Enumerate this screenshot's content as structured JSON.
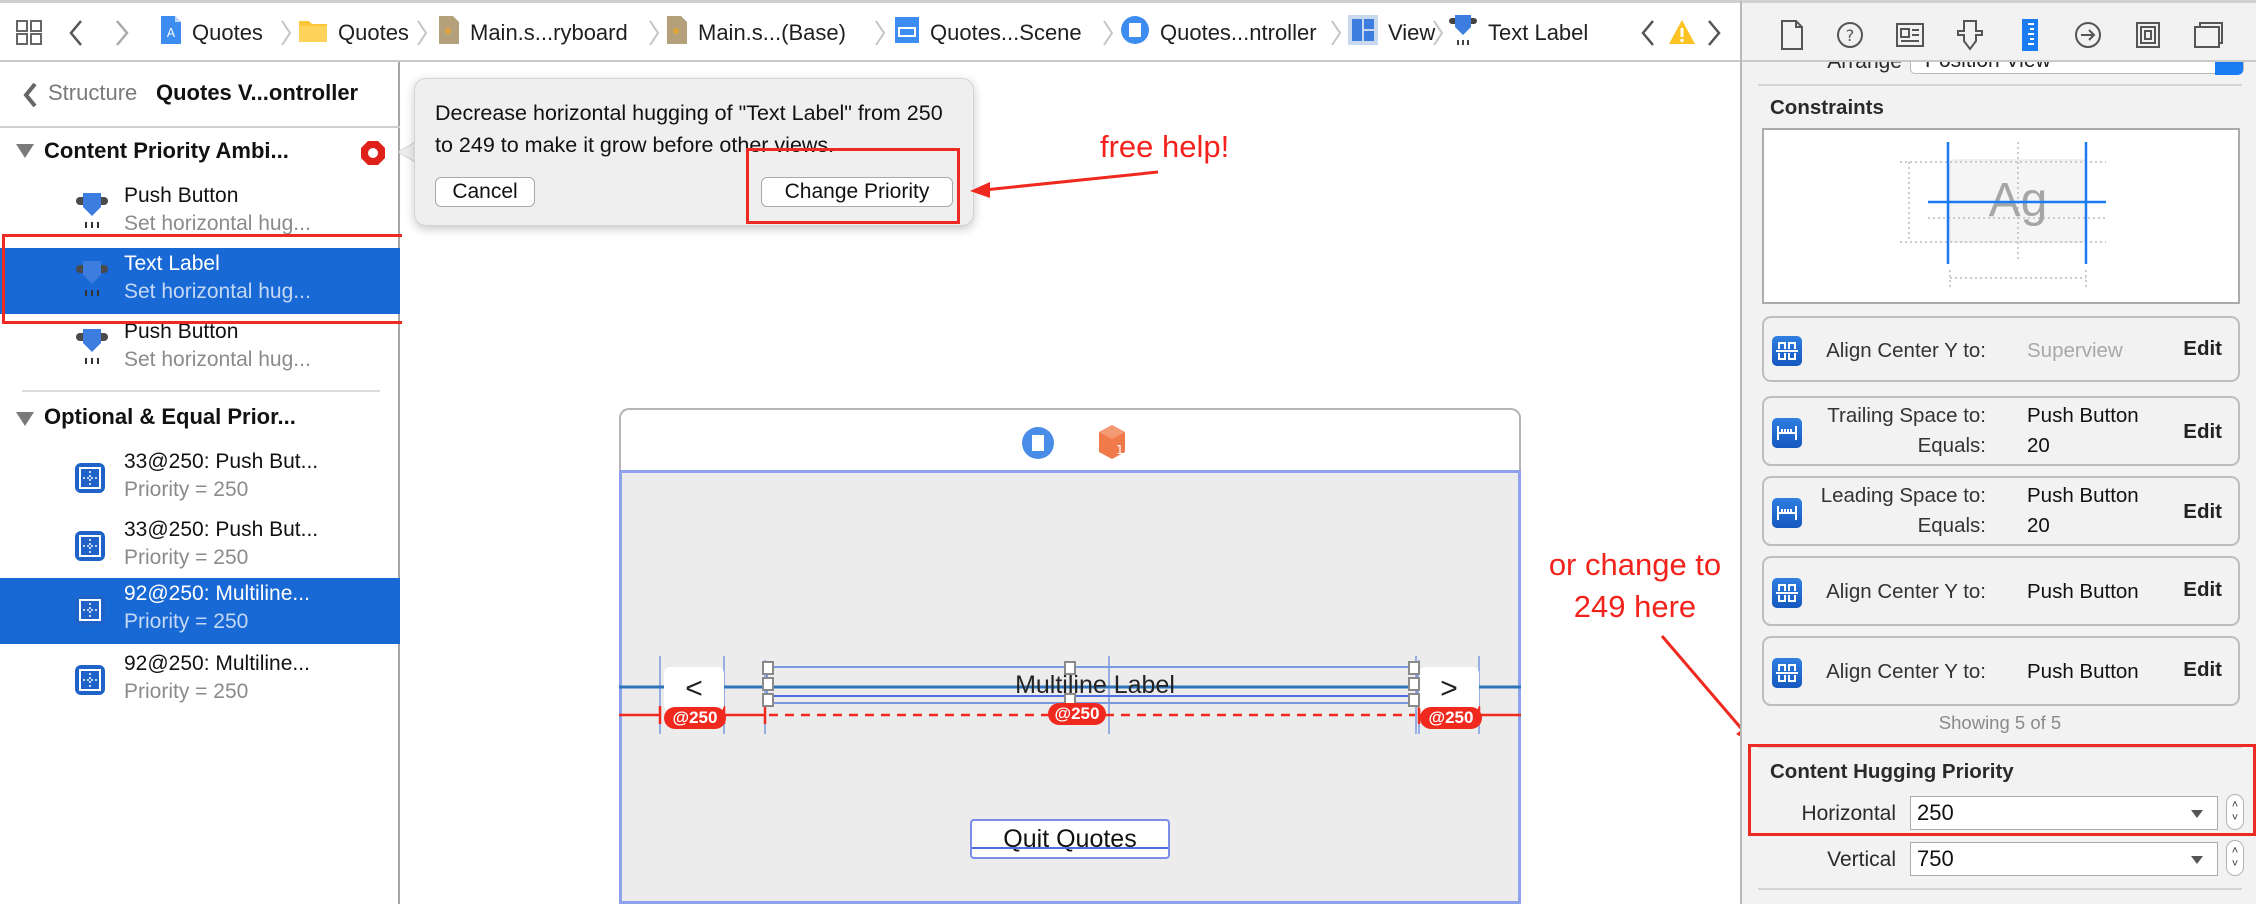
{
  "jumpbar": {
    "breadcrumbs": [
      {
        "label": "Quotes",
        "icon": "project-icon"
      },
      {
        "label": "Quotes",
        "icon": "folder-icon"
      },
      {
        "label": "Main.s...ryboard",
        "icon": "storyboard-file-icon"
      },
      {
        "label": "Main.s...(Base)",
        "icon": "storyboard-file-icon"
      },
      {
        "label": "Quotes...Scene",
        "icon": "scene-icon"
      },
      {
        "label": "Quotes...ntroller",
        "icon": "view-controller-icon"
      },
      {
        "label": "View",
        "icon": "view-icon"
      },
      {
        "label": "Text Label",
        "icon": "label-icon"
      }
    ],
    "issue_status": "warning"
  },
  "inspector_tabs": [
    {
      "name": "file-inspector",
      "icon": "file-icon",
      "active": false
    },
    {
      "name": "quick-help",
      "icon": "help-icon",
      "active": false
    },
    {
      "name": "identity-inspector",
      "icon": "identity-icon",
      "active": false
    },
    {
      "name": "attributes-inspector",
      "icon": "attributes-icon",
      "active": false
    },
    {
      "name": "size-inspector",
      "icon": "ruler-icon",
      "active": true
    },
    {
      "name": "connections-inspector",
      "icon": "arrow-circle-icon",
      "active": false
    },
    {
      "name": "bindings-inspector",
      "icon": "bindings-icon",
      "active": false
    },
    {
      "name": "view-effects-inspector",
      "icon": "effects-icon",
      "active": false
    }
  ],
  "outline": {
    "back_label": "Structure",
    "title": "Quotes V...ontroller",
    "sections": [
      {
        "title": "Content Priority Ambi...",
        "status": "error",
        "items": [
          {
            "title": "Push Button",
            "subtitle": "Set horizontal hug...",
            "selected": false
          },
          {
            "title": "Text Label",
            "subtitle": "Set horizontal hug...",
            "selected": true
          },
          {
            "title": "Push Button",
            "subtitle": "Set horizontal hug...",
            "selected": false
          }
        ]
      },
      {
        "title": "Optional & Equal Prior...",
        "items": [
          {
            "title": "33@250: Push But...",
            "subtitle": "Priority = 250",
            "selected": false
          },
          {
            "title": "33@250: Push But...",
            "subtitle": "Priority = 250",
            "selected": false
          },
          {
            "title": "92@250: Multiline...",
            "subtitle": "Priority = 250",
            "selected": true
          },
          {
            "title": "92@250: Multiline...",
            "subtitle": "Priority = 250",
            "selected": false
          }
        ]
      }
    ]
  },
  "popover": {
    "message": "Decrease horizontal hugging of \"Text Label\" from 250 to 249 to make it grow before other views.",
    "cancel_label": "Cancel",
    "confirm_label": "Change Priority"
  },
  "annotations": {
    "free_help": "free help!",
    "change_here_line1": "or change to",
    "change_here_line2": "249 here",
    "color": "#f2231c"
  },
  "scene": {
    "prev_button": "<",
    "next_button": ">",
    "label_text": "Multiline Label",
    "quit_button": "Quit Quotes",
    "priority_badges": [
      "@250",
      "@250",
      "@250"
    ]
  },
  "inspector": {
    "arrange_label": "Arrange",
    "arrange_value": "Position View",
    "constraints_title": "Constraints",
    "diagram_sample": "Ag",
    "constraints": [
      {
        "label": "Align Center Y to:",
        "target": "Superview",
        "target_dim": true,
        "equals": null,
        "icon": "align-center-y-icon"
      },
      {
        "label": "Trailing Space to:",
        "target": "Push Button",
        "target_dim": false,
        "equals_label": "Equals:",
        "equals": "20",
        "icon": "spacing-icon"
      },
      {
        "label": "Leading Space to:",
        "target": "Push Button",
        "target_dim": false,
        "equals_label": "Equals:",
        "equals": "20",
        "icon": "spacing-icon"
      },
      {
        "label": "Align Center Y to:",
        "target": "Push Button",
        "target_dim": false,
        "equals": null,
        "icon": "align-center-y-icon"
      },
      {
        "label": "Align Center Y to:",
        "target": "Push Button",
        "target_dim": false,
        "equals": null,
        "icon": "align-center-y-icon"
      }
    ],
    "edit_label": "Edit",
    "showing": "Showing 5 of 5",
    "hugging": {
      "title": "Content Hugging Priority",
      "horizontal_label": "Horizontal",
      "horizontal_value": "250",
      "vertical_label": "Vertical",
      "vertical_value": "750"
    }
  },
  "colors": {
    "selection": "#1869d5",
    "accent_blue": "#1a7cf2",
    "error_red": "#e0201a",
    "constraint_red": "#f0291f",
    "warning_yellow": "#fdc223"
  }
}
